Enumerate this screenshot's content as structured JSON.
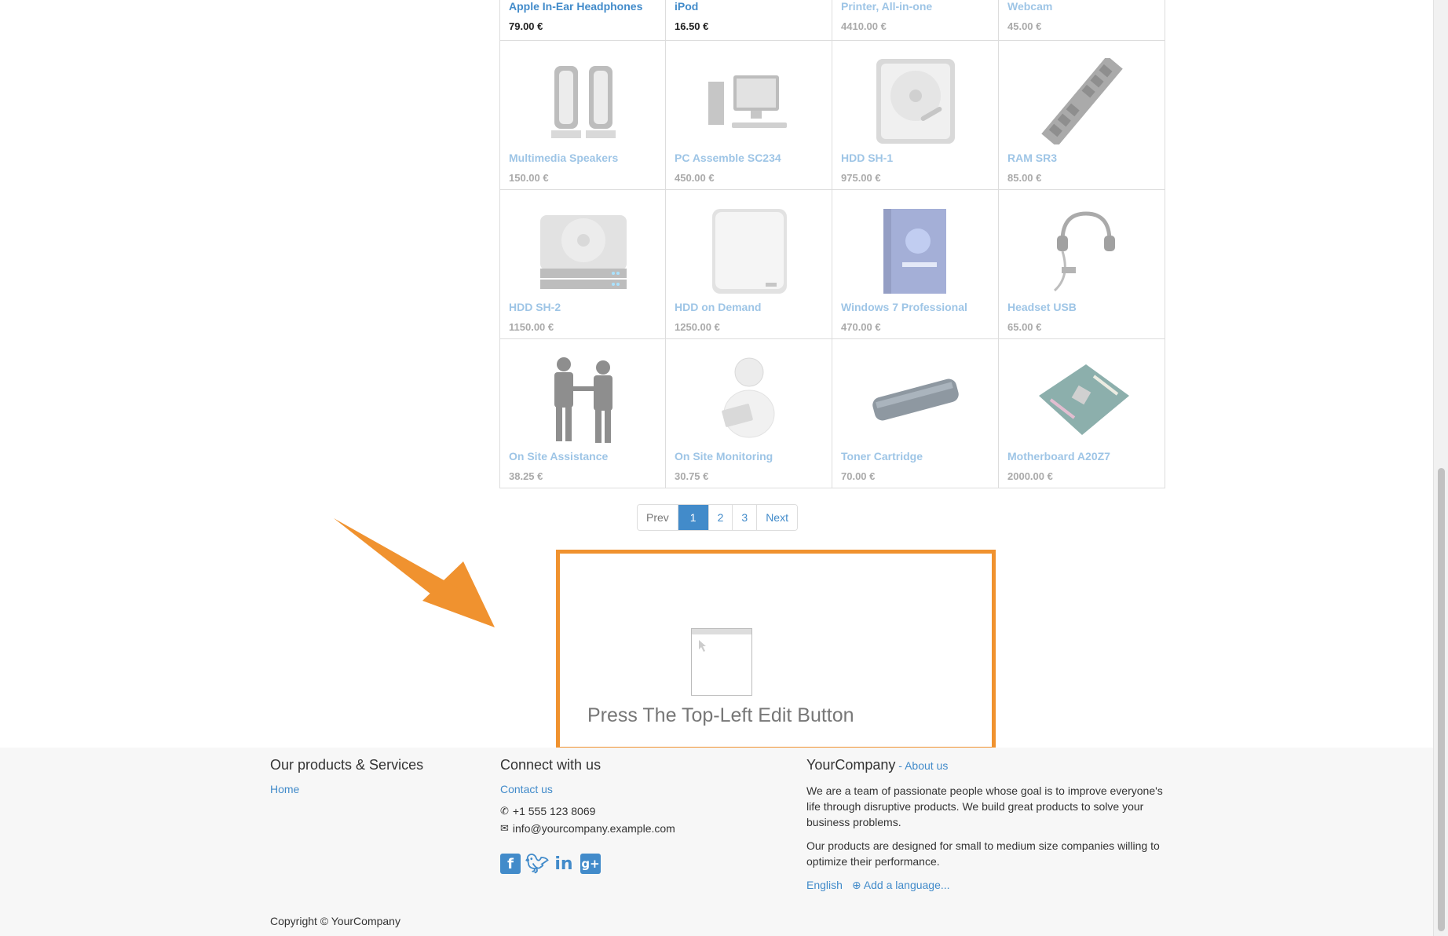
{
  "products": [
    {
      "name": "Apple In-Ear Headphones",
      "price": "79.00 €",
      "icon": "headphones-icon"
    },
    {
      "name": "iPod",
      "price": "16.50 €",
      "icon": "ipod-icon"
    },
    {
      "name": "Printer, All-in-one",
      "price": "4410.00 €",
      "icon": "printer-icon"
    },
    {
      "name": "Webcam",
      "price": "45.00 €",
      "icon": "webcam-icon"
    },
    {
      "name": "Multimedia Speakers",
      "price": "150.00 €",
      "icon": "speakers-icon"
    },
    {
      "name": "PC Assemble SC234",
      "price": "450.00 €",
      "icon": "pc-icon"
    },
    {
      "name": "HDD SH-1",
      "price": "975.00 €",
      "icon": "hdd-icon"
    },
    {
      "name": "RAM SR3",
      "price": "85.00 €",
      "icon": "ram-icon"
    },
    {
      "name": "HDD SH-2",
      "price": "1150.00 €",
      "icon": "hdd-stack-icon"
    },
    {
      "name": "HDD on Demand",
      "price": "1250.00 €",
      "icon": "external-drive-icon"
    },
    {
      "name": "Windows 7 Professional",
      "price": "470.00 €",
      "icon": "software-box-icon"
    },
    {
      "name": "Headset USB",
      "price": "65.00 €",
      "icon": "headset-icon"
    },
    {
      "name": "On Site Assistance",
      "price": "38.25 €",
      "icon": "handshake-icon"
    },
    {
      "name": "On Site Monitoring",
      "price": "30.75 €",
      "icon": "laptop-person-icon"
    },
    {
      "name": "Toner Cartridge",
      "price": "70.00 €",
      "icon": "toner-icon"
    },
    {
      "name": "Motherboard A20Z7",
      "price": "2000.00 €",
      "icon": "motherboard-icon"
    }
  ],
  "pagination": {
    "prev": "Prev",
    "pages": [
      "1",
      "2",
      "3"
    ],
    "active": "1",
    "next": "Next"
  },
  "snippet": {
    "text": "Press The Top-Left Edit Button",
    "accent": "#f0922f"
  },
  "footer": {
    "col1": {
      "title": "Our products & Services",
      "link": "Home"
    },
    "col2": {
      "title": "Connect with us",
      "contact": "Contact us",
      "phone": "+1 555 123 8069",
      "email": "info@yourcompany.example.com",
      "social": [
        "facebook-icon",
        "twitter-icon",
        "linkedin-icon",
        "google-plus-icon"
      ]
    },
    "col3": {
      "title": "YourCompany",
      "about_sep": " - ",
      "about": "About us",
      "p1": "We are a team of passionate people whose goal is to improve everyone's life through disruptive products. We build great products to solve your business problems.",
      "p2": "Our products are designed for small to medium size companies willing to optimize their performance.",
      "lang": "English",
      "add_lang": "Add a language..."
    },
    "copyright": "Copyright © YourCompany"
  },
  "colors": {
    "link": "#428bca",
    "accent": "#f0922f",
    "footer_bg": "#f7f7f7"
  }
}
